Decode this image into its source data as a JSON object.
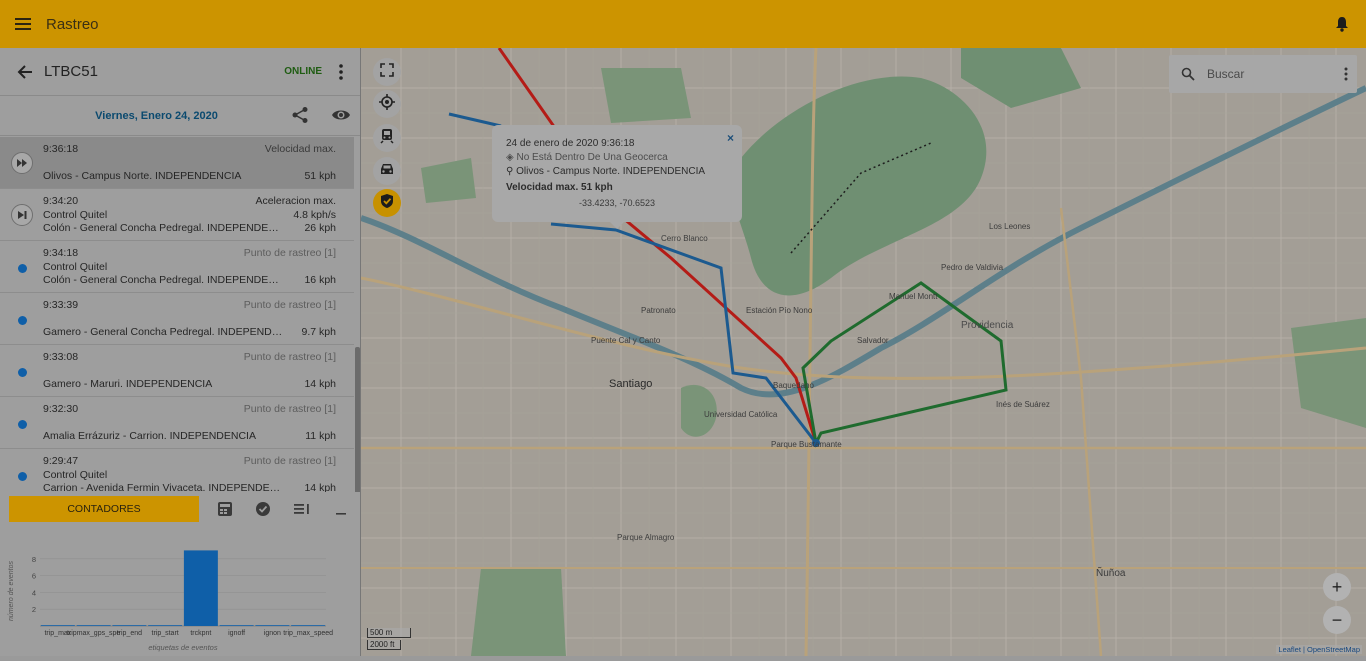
{
  "app": {
    "title": "Rastreo"
  },
  "device": {
    "name": "LTBC51",
    "status": "ONLINE"
  },
  "date": {
    "label": "Viernes, Enero 24, 2020"
  },
  "events": [
    {
      "time": "9:36:18",
      "label": "Velocidad max.",
      "line2": "",
      "address": "Olivos - Campus Norte. INDEPENDENCIA",
      "speed": "51 kph"
    },
    {
      "time": "9:34:20",
      "label": "Aceleracion max.",
      "line2": "Control Quitel",
      "accel": "4.8 kph/s",
      "address": "Colón - General Concha Pedregal. INDEPENDENCIA",
      "speed": "26 kph"
    },
    {
      "time": "9:34:18",
      "label": "Punto de rastreo [1]",
      "line2": "Control Quitel",
      "address": "Colón - General Concha Pedregal. INDEPENDENCIA",
      "speed": "16 kph"
    },
    {
      "time": "9:33:39",
      "label": "Punto de rastreo [1]",
      "line2": "",
      "address": "Gamero - General Concha Pedregal. INDEPENDENCIA",
      "speed": "9.7 kph"
    },
    {
      "time": "9:33:08",
      "label": "Punto de rastreo [1]",
      "line2": "",
      "address": "Gamero - Maruri. INDEPENDENCIA",
      "speed": "14 kph"
    },
    {
      "time": "9:32:30",
      "label": "Punto de rastreo [1]",
      "line2": "",
      "address": "Amalia Errázuriz - Carrion. INDEPENDENCIA",
      "speed": "11 kph"
    },
    {
      "time": "9:29:47",
      "label": "Punto de rastreo [1]",
      "line2": "Control Quitel",
      "address": "Carrion - Avenida Fermin Vivaceta. INDEPENDENCIA",
      "speed": "14 kph"
    }
  ],
  "tabs": {
    "counters": "CONTADORES"
  },
  "chart_data": {
    "type": "bar",
    "categories": [
      "trip_max",
      "trip_max_gps_speed",
      "trip_end",
      "trip_start",
      "trckpnt",
      "ignoff",
      "ignon",
      "trip_max_speed"
    ],
    "tick_labels": [
      "trip_max",
      "tripmax_gps_spe",
      "trip_end",
      "trip_start",
      "trckpnt",
      "ignoff",
      "ignon",
      "trip_max_speed"
    ],
    "values": [
      0,
      0,
      0,
      0,
      9,
      0,
      0,
      0
    ],
    "ylim": [
      0,
      10
    ],
    "yticks": [
      "2",
      "4",
      "6",
      "8"
    ],
    "xlabel": "etiquetas de eventos",
    "ylabel": "número de eventos",
    "color": "#0f5fa8"
  },
  "map": {
    "search_placeholder": "Buscar",
    "popup": {
      "title": "24 de enero de 2020 9:36:18",
      "geofence": "No Está Dentro De Una Geocerca",
      "address": "Olivos - Campus Norte. INDEPENDENCIA",
      "speed": "Velocidad max.  51 kph",
      "coords": "-33.4233, -70.6523"
    },
    "scale_m": "500 m",
    "scale_ft": "2000 ft",
    "attribution": "Leaflet | OpenStreetMap",
    "zoom_in": "+",
    "zoom_out": "−",
    "labels": [
      "Santiago",
      "Providencia",
      "Ñuñoa",
      "Parque Bustamante",
      "Estación Pío Nono",
      "Universidad Católica",
      "Cerro Blanco",
      "Patronato",
      "Parque Almagro",
      "Puente Cal y Canto",
      "Manuel Montt",
      "Los Leones",
      "Inés de Suárez",
      "Pedro de Valdivia",
      "Salvador",
      "Baquedano"
    ]
  }
}
